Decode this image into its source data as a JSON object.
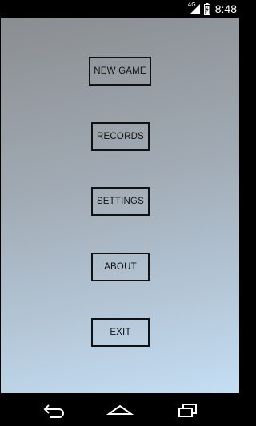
{
  "status_bar": {
    "network_label": "4G",
    "time": "8:48"
  },
  "menu": {
    "new_game": "NEW GAME",
    "records": "RECORDS",
    "settings": "SETTINGS",
    "about": "ABOUT",
    "exit": "EXIT"
  },
  "nav_bar": {
    "icons": [
      "back-icon",
      "home-icon",
      "recents-icon"
    ]
  },
  "colors": {
    "gradient_top": "#8a8d90",
    "gradient_bottom": "#c4def4",
    "button_border": "#111111"
  }
}
